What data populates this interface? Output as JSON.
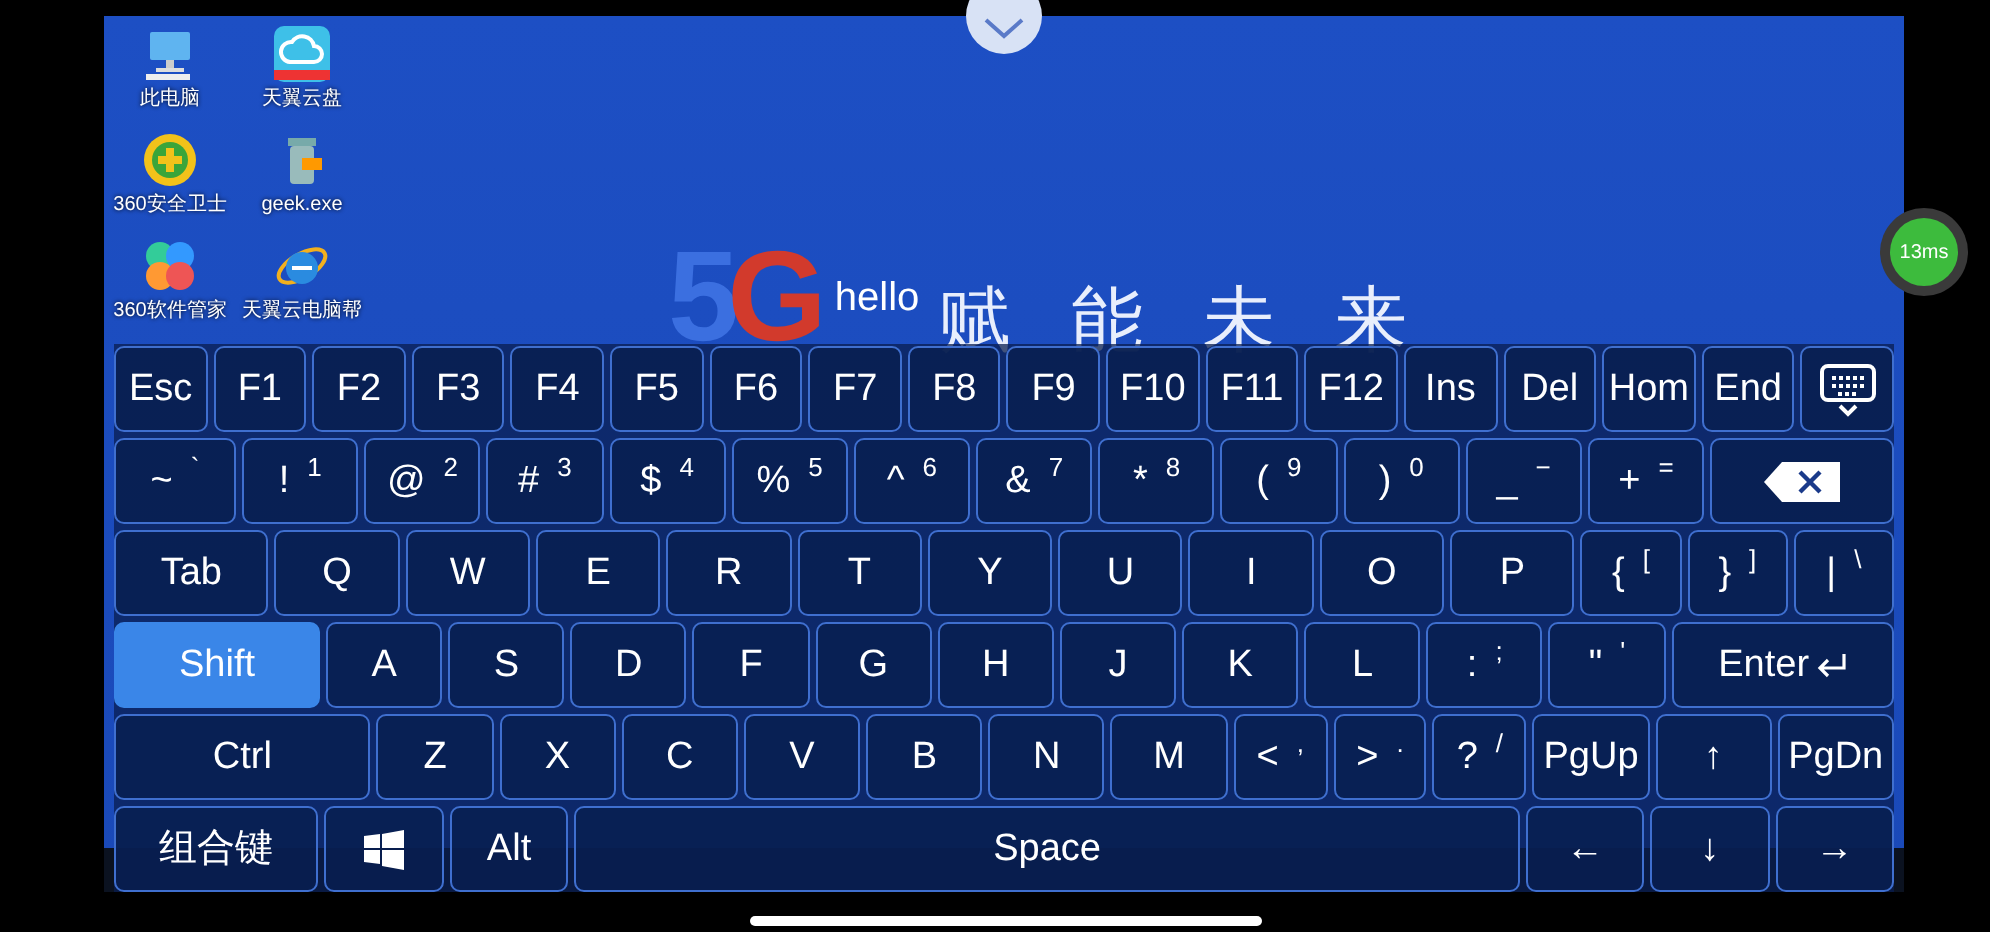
{
  "desktop": {
    "icons": [
      {
        "kind": "computer",
        "label": "此电脑"
      },
      {
        "kind": "cloud",
        "label": "天翼云盘"
      },
      {
        "kind": "shield",
        "label": "360安全卫士"
      },
      {
        "kind": "bin",
        "label": "geek.exe"
      },
      {
        "kind": "flower",
        "label": "360软件管家"
      },
      {
        "kind": "browser",
        "label": "天翼云电脑帮"
      }
    ],
    "banner": {
      "logo": "5G",
      "greeting": "hello",
      "slogan": "赋能未来"
    }
  },
  "latency": "13ms",
  "keyboard": {
    "rows": [
      {
        "keys": [
          {
            "kind": "key",
            "label": "Esc",
            "pressed": false
          },
          {
            "kind": "key",
            "label": "F1",
            "pressed": false
          },
          {
            "kind": "key",
            "label": "F2",
            "pressed": false
          },
          {
            "kind": "key",
            "label": "F3",
            "pressed": false
          },
          {
            "kind": "key",
            "label": "F4",
            "pressed": false
          },
          {
            "kind": "key",
            "label": "F5",
            "pressed": false
          },
          {
            "kind": "key",
            "label": "F6",
            "pressed": false
          },
          {
            "kind": "key",
            "label": "F7",
            "pressed": false
          },
          {
            "kind": "key",
            "label": "F8",
            "pressed": false
          },
          {
            "kind": "key",
            "label": "F9",
            "pressed": false
          },
          {
            "kind": "key",
            "label": "F10",
            "pressed": false
          },
          {
            "kind": "key",
            "label": "F11",
            "pressed": false
          },
          {
            "kind": "key",
            "label": "F12",
            "pressed": false
          },
          {
            "kind": "key",
            "label": "Ins",
            "pressed": false
          },
          {
            "kind": "key",
            "label": "Del",
            "pressed": false
          },
          {
            "kind": "key",
            "label": "Hom",
            "pressed": false
          },
          {
            "kind": "key",
            "label": "End",
            "pressed": false
          },
          {
            "kind": "kbd-toggle",
            "pressed": false
          }
        ]
      },
      {
        "keys": [
          {
            "kind": "tilde",
            "label": "~",
            "sub": "`",
            "pressed": false
          },
          {
            "kind": "key",
            "label": "!",
            "sub": "1",
            "pressed": false
          },
          {
            "kind": "key",
            "label": "@",
            "sub": "2",
            "pressed": false
          },
          {
            "kind": "key",
            "label": "#",
            "sub": "3",
            "pressed": false
          },
          {
            "kind": "key",
            "label": "$",
            "sub": "4",
            "pressed": false
          },
          {
            "kind": "key",
            "label": "%",
            "sub": "5",
            "pressed": false
          },
          {
            "kind": "key",
            "label": "^",
            "sub": "6",
            "pressed": false
          },
          {
            "kind": "key",
            "label": "&",
            "sub": "7",
            "pressed": false
          },
          {
            "kind": "key",
            "label": "*",
            "sub": "8",
            "pressed": false
          },
          {
            "kind": "key",
            "label": "(",
            "sub": "9",
            "pressed": false
          },
          {
            "kind": "key",
            "label": ")",
            "sub": "0",
            "pressed": false
          },
          {
            "kind": "key",
            "label": "_",
            "sub": "−",
            "pressed": false
          },
          {
            "kind": "key",
            "label": "+",
            "sub": "=",
            "pressed": false
          },
          {
            "kind": "backspace",
            "pressed": false
          }
        ]
      },
      {
        "keys": [
          {
            "kind": "tab",
            "label": "Tab",
            "pressed": false
          },
          {
            "kind": "key",
            "label": "Q",
            "pressed": false
          },
          {
            "kind": "key",
            "label": "W",
            "pressed": false
          },
          {
            "kind": "key",
            "label": "E",
            "pressed": false
          },
          {
            "kind": "key",
            "label": "R",
            "pressed": false
          },
          {
            "kind": "key",
            "label": "T",
            "pressed": false
          },
          {
            "kind": "key",
            "label": "Y",
            "pressed": false
          },
          {
            "kind": "key",
            "label": "U",
            "pressed": false
          },
          {
            "kind": "key",
            "label": "I",
            "pressed": false
          },
          {
            "kind": "key",
            "label": "O",
            "pressed": false
          },
          {
            "kind": "key",
            "label": "P",
            "pressed": false
          },
          {
            "kind": "narrow",
            "label": "{",
            "sub": "[",
            "pressed": false
          },
          {
            "kind": "narrow",
            "label": "}",
            "sub": "]",
            "pressed": false
          },
          {
            "kind": "narrow",
            "label": "|",
            "sub": "\\",
            "pressed": false
          }
        ]
      },
      {
        "keys": [
          {
            "kind": "shift",
            "label": "Shift",
            "pressed": true
          },
          {
            "kind": "key",
            "label": "A",
            "pressed": false
          },
          {
            "kind": "key",
            "label": "S",
            "pressed": false
          },
          {
            "kind": "key",
            "label": "D",
            "pressed": false
          },
          {
            "kind": "key",
            "label": "F",
            "pressed": false
          },
          {
            "kind": "key",
            "label": "G",
            "pressed": false
          },
          {
            "kind": "key",
            "label": "H",
            "pressed": false
          },
          {
            "kind": "key",
            "label": "J",
            "pressed": false
          },
          {
            "kind": "key",
            "label": "K",
            "pressed": false
          },
          {
            "kind": "key",
            "label": "L",
            "pressed": false
          },
          {
            "kind": "key",
            "label": ":",
            "sub": ";",
            "pressed": false
          },
          {
            "kind": "key",
            "label": "\"",
            "sub": "'",
            "pressed": false
          },
          {
            "kind": "enter",
            "label": "Enter",
            "pressed": false
          }
        ]
      },
      {
        "keys": [
          {
            "kind": "ctrl",
            "label": "Ctrl",
            "pressed": false
          },
          {
            "kind": "key",
            "label": "Z",
            "pressed": false
          },
          {
            "kind": "key",
            "label": "X",
            "pressed": false
          },
          {
            "kind": "key",
            "label": "C",
            "pressed": false
          },
          {
            "kind": "key",
            "label": "V",
            "pressed": false
          },
          {
            "kind": "key",
            "label": "B",
            "pressed": false
          },
          {
            "kind": "key",
            "label": "N",
            "pressed": false
          },
          {
            "kind": "key",
            "label": "M",
            "pressed": false
          },
          {
            "kind": "narrow",
            "label": "<",
            "sub": ",",
            "pressed": false
          },
          {
            "kind": "narrow",
            "label": ">",
            "sub": ".",
            "pressed": false
          },
          {
            "kind": "narrow",
            "label": "?",
            "sub": "/",
            "pressed": false
          },
          {
            "kind": "key",
            "label": "PgUp",
            "pressed": false
          },
          {
            "kind": "key",
            "label": "↑",
            "pressed": false
          },
          {
            "kind": "key",
            "label": "PgDn",
            "pressed": false
          }
        ]
      },
      {
        "keys": [
          {
            "kind": "combo",
            "label": "组合键",
            "pressed": false
          },
          {
            "kind": "win",
            "pressed": false
          },
          {
            "kind": "key",
            "label": "Alt",
            "pressed": false
          },
          {
            "kind": "space",
            "label": "Space",
            "pressed": false
          },
          {
            "kind": "key",
            "label": "←",
            "pressed": false
          },
          {
            "kind": "key",
            "label": "↓",
            "pressed": false
          },
          {
            "kind": "key",
            "label": "→",
            "pressed": false
          }
        ]
      }
    ]
  }
}
